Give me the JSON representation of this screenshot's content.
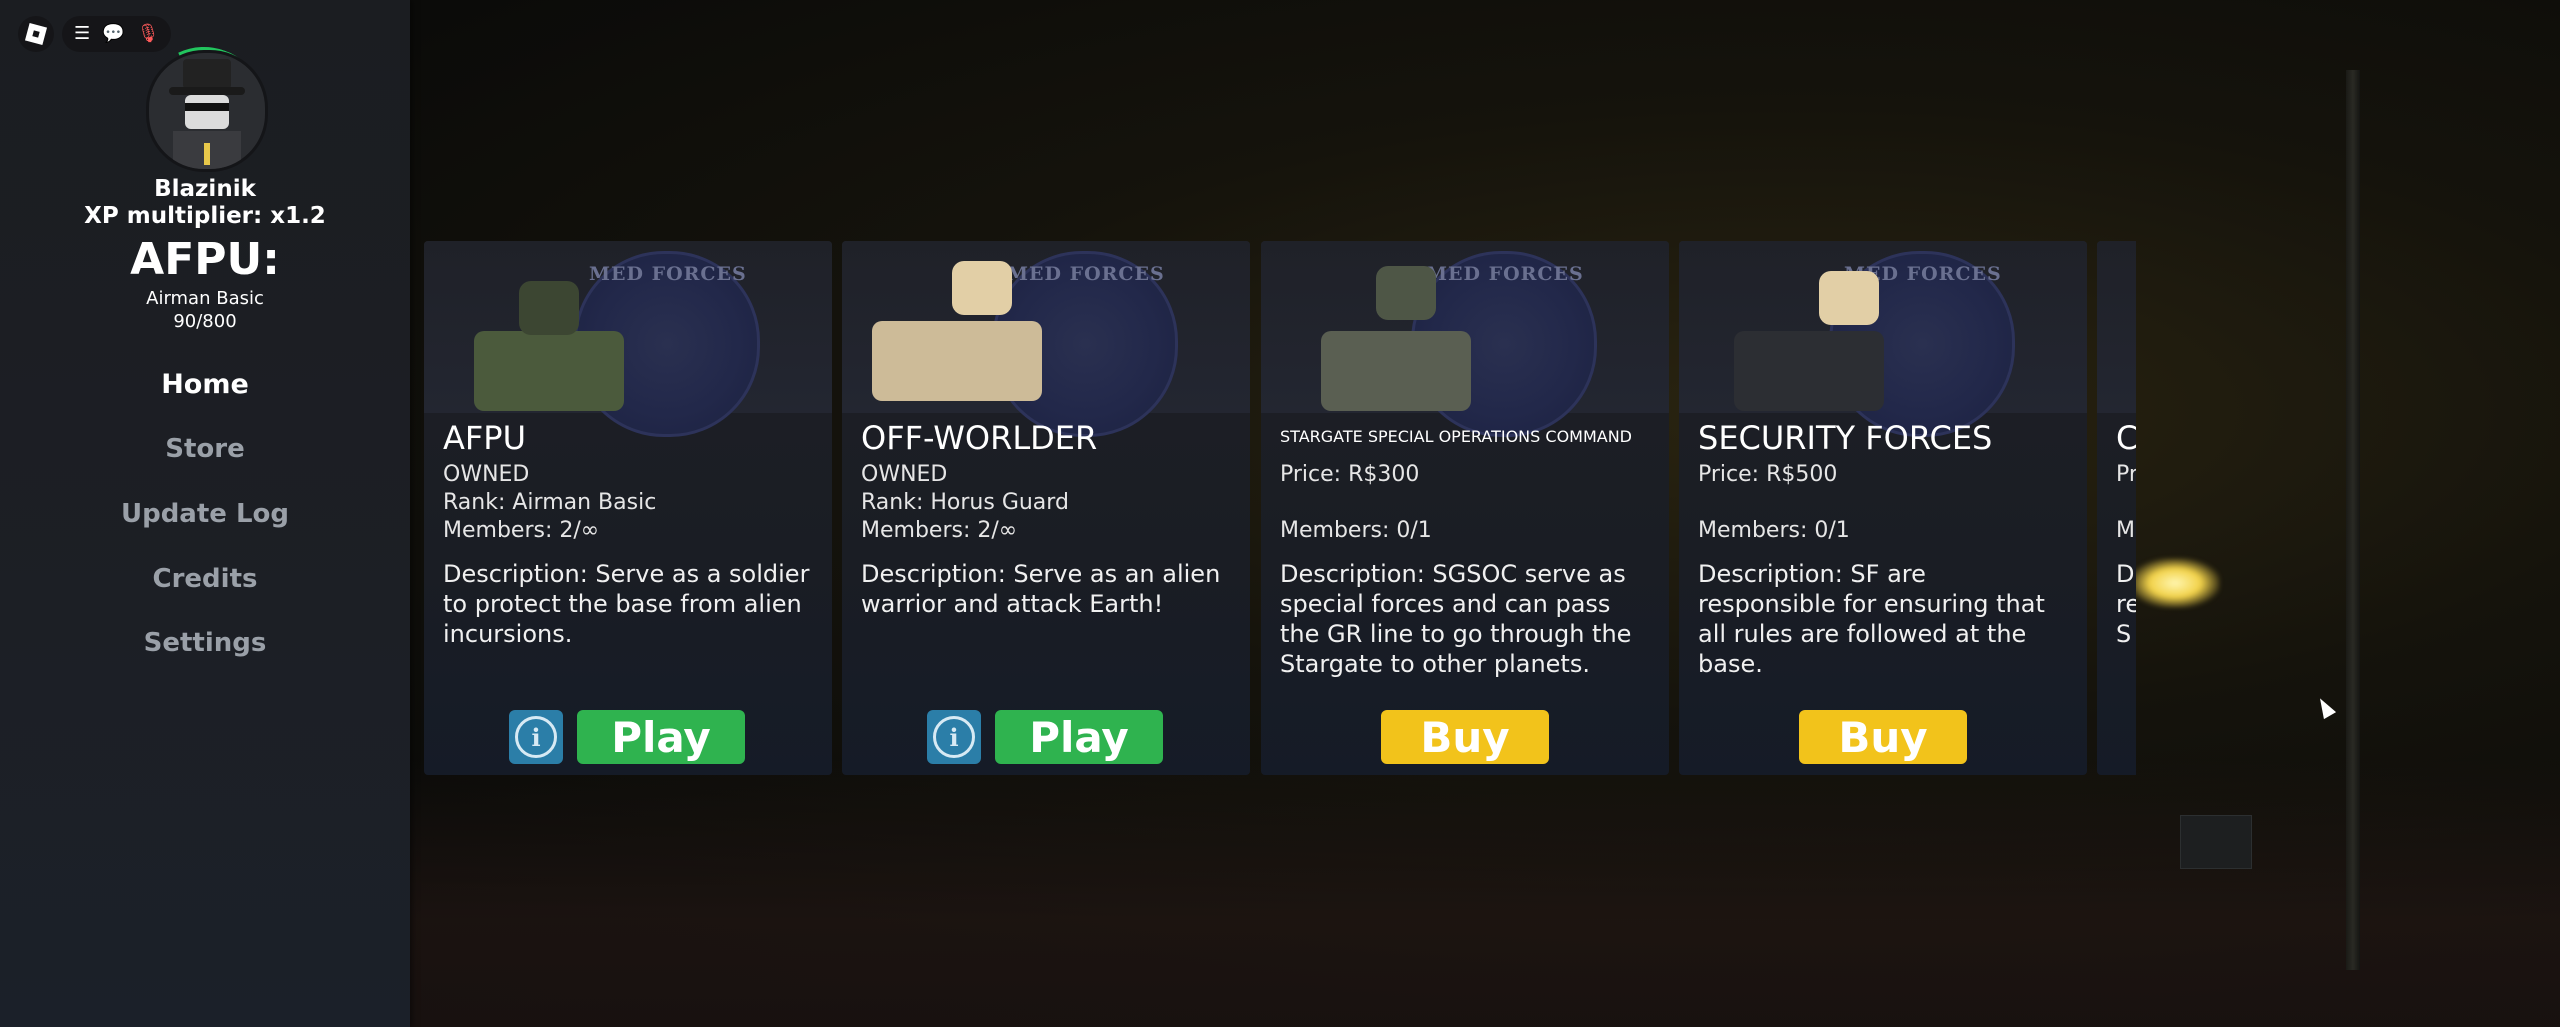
{
  "topbar": {
    "icons": [
      "roblox-logo-icon",
      "menu-icon",
      "chat-icon",
      "microphone-muted-icon"
    ],
    "glyphs": {
      "menu": "☰",
      "chat": "💬",
      "mic": "🎙"
    }
  },
  "sidebar": {
    "username": "Blazinik",
    "xp_multiplier": "XP multiplier: x1.2",
    "team": "AFPU:",
    "rank": "Airman Basic",
    "xp": "90/800",
    "nav": [
      "Home",
      "Store",
      "Update Log",
      "Credits",
      "Settings"
    ],
    "active_nav": "Home"
  },
  "emblem_text": "MED FORCES",
  "cards": [
    {
      "title": "AFPU",
      "line1": "OWNED",
      "line2": "Rank: Airman Basic",
      "line3": "Members: 2/∞",
      "description": "Description: Serve as a soldier to protect the base from alien incursions.",
      "info_glyph": "i",
      "action": "Play"
    },
    {
      "title": "OFF-WORLDER",
      "line1": "OWNED",
      "line2": "Rank: Horus Guard",
      "line3": "Members: 2/∞",
      "description": "Description: Serve as an alien warrior and attack Earth!",
      "info_glyph": "i",
      "action": "Play"
    },
    {
      "title": "STARGATE SPECIAL OPERATIONS COMMAND",
      "line1": "Price: R$300",
      "line2": "",
      "line3": "Members: 0/1",
      "description": "Description: SGSOC serve as special forces and can pass the GR line to go through the Stargate to other planets.",
      "action": "Buy"
    },
    {
      "title": "SECURITY FORCES",
      "line1": "Price: R$500",
      "line2": "",
      "line3": "Members: 0/1",
      "description": "Description: SF are responsible for ensuring that all rules are followed at the base.",
      "action": "Buy"
    },
    {
      "title": "C",
      "line1": "Pr",
      "line2": "",
      "line3": "M",
      "description": "D\nre\nS"
    }
  ],
  "colors": {
    "play": "#2fb34f",
    "buy": "#f2c31b",
    "info": "#2b7ea8",
    "sidebar_bg": "#1c1f25",
    "nav_inactive": "#9aa0a8"
  }
}
